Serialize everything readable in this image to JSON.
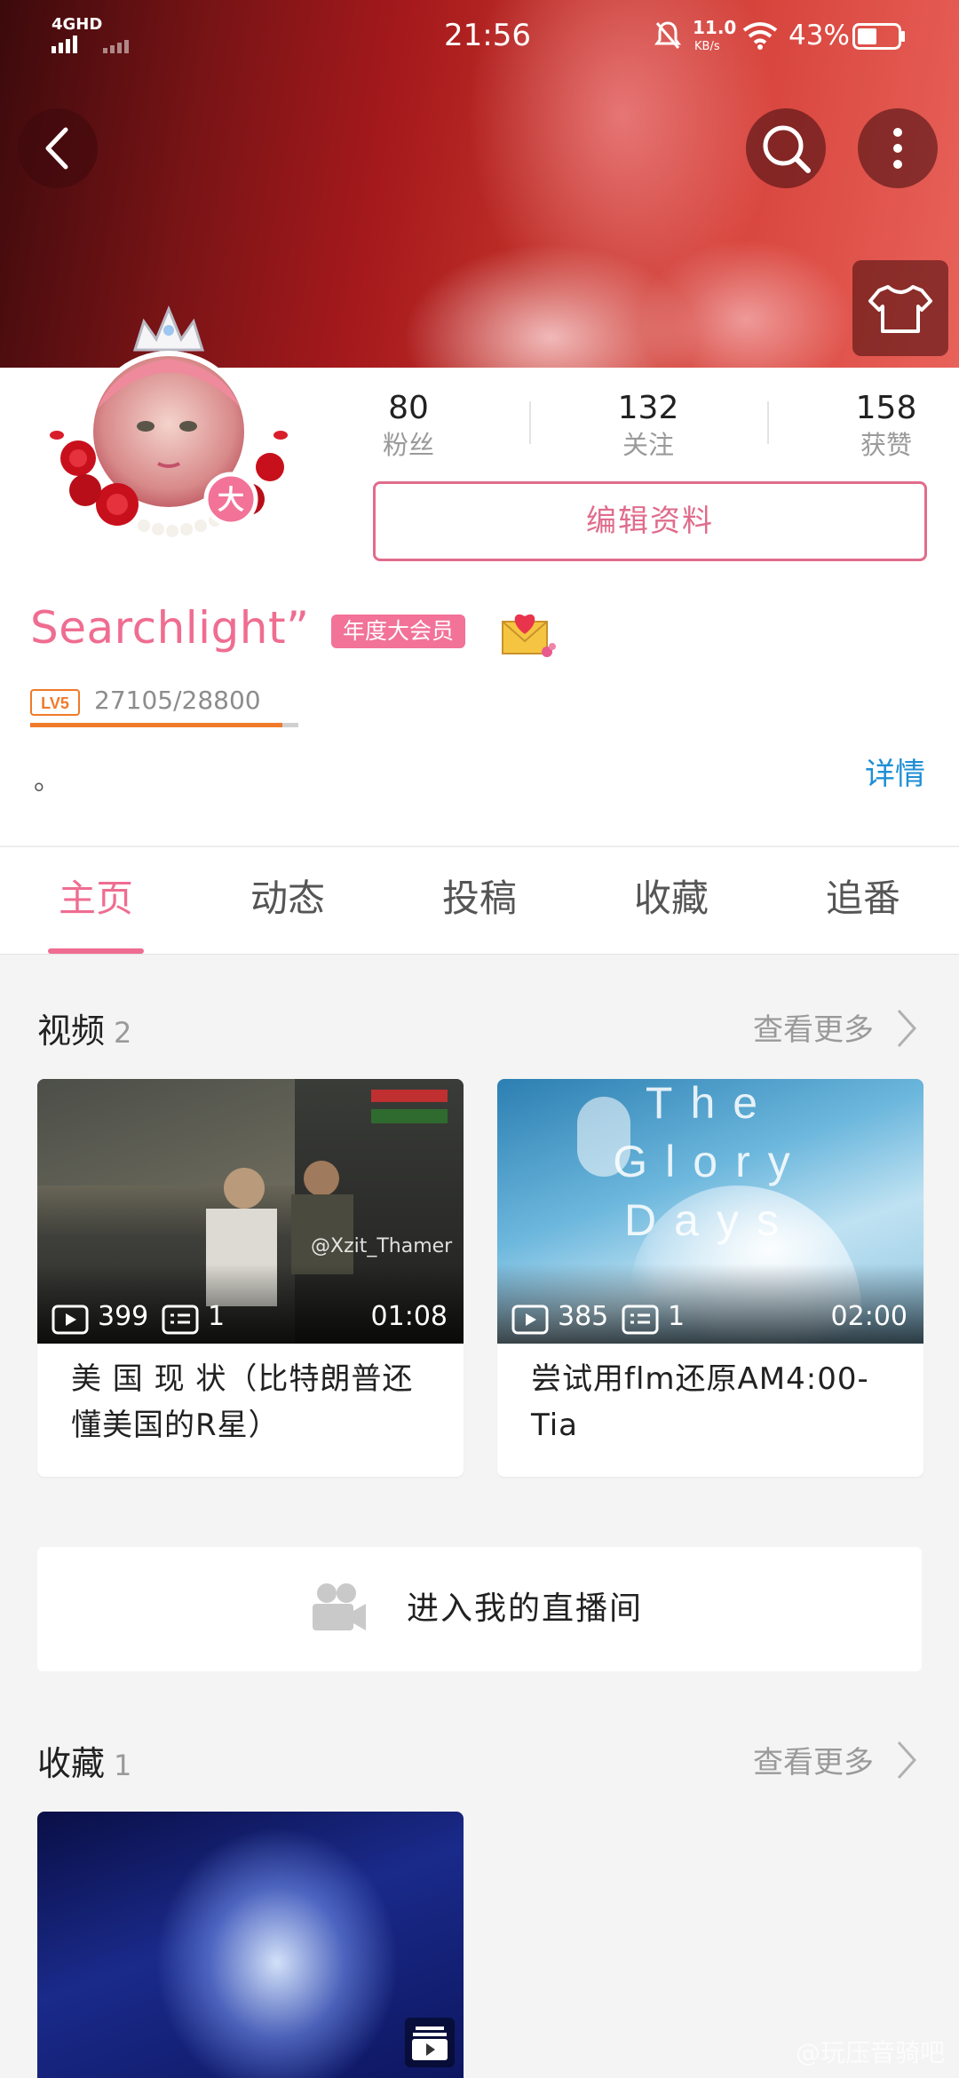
{
  "status_bar": {
    "network": "4GHD",
    "time": "21:56",
    "speed_value": "11.0",
    "speed_unit": "KB/s",
    "battery": "43%"
  },
  "profile": {
    "stats": [
      {
        "value": "80",
        "label": "粉丝"
      },
      {
        "value": "132",
        "label": "关注"
      },
      {
        "value": "158",
        "label": "获赞"
      }
    ],
    "edit_label": "编辑资料",
    "avatar_badge": "大",
    "username": "Searchlightˮ",
    "vip_label": "年度大会员",
    "level": "LV5",
    "exp_text": "27105/28800",
    "exp_progress": 0.941,
    "signature": "。",
    "detail_label": "详情"
  },
  "tabs": [
    {
      "label": "主页",
      "active": true
    },
    {
      "label": "动态",
      "active": false
    },
    {
      "label": "投稿",
      "active": false
    },
    {
      "label": "收藏",
      "active": false
    },
    {
      "label": "追番",
      "active": false
    }
  ],
  "videos_section": {
    "title": "视频",
    "count": "2",
    "more_label": "查看更多",
    "items": [
      {
        "views": "399",
        "comments": "1",
        "duration": "01:08",
        "title": "美 国 现 状（比特朗普还懂美国的R星）",
        "thumb_watermark": "@Xzit_Thamer"
      },
      {
        "views": "385",
        "comments": "1",
        "duration": "02:00",
        "title": "尝试用flm还原AM4:00-Tia",
        "thumb_text": "The Glory Days"
      }
    ]
  },
  "live_room": {
    "label": "进入我的直播间"
  },
  "favorites_section": {
    "title": "收藏",
    "count": "1",
    "more_label": "查看更多"
  },
  "watermark": "@玩压音骑吧",
  "colors": {
    "accent_pink": "#ef6d91",
    "link_blue": "#1e8fd5",
    "level_orange": "#f07a2a"
  }
}
